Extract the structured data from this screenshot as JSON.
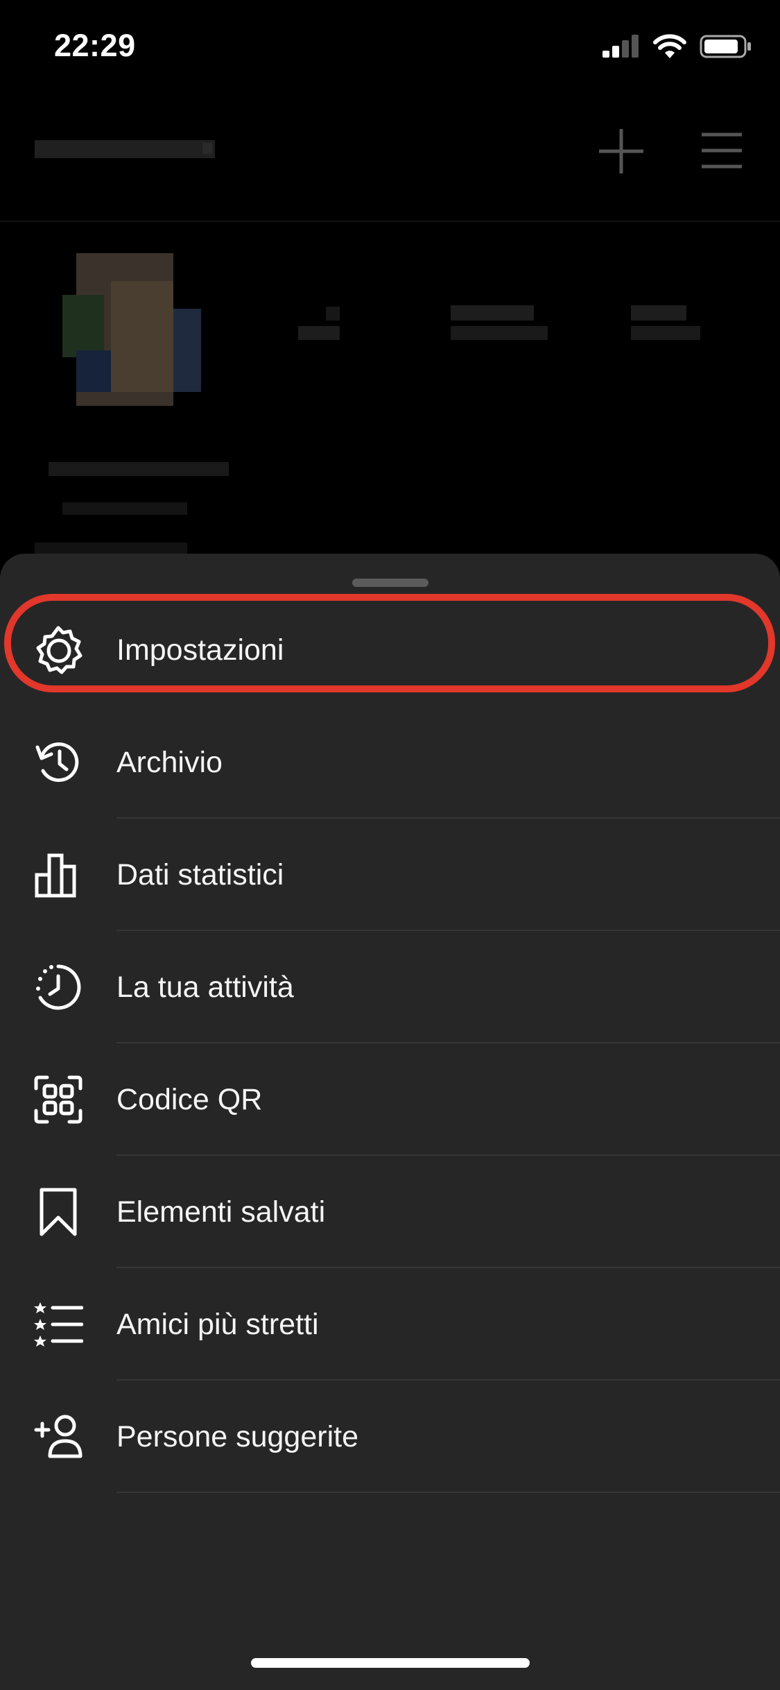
{
  "status_bar": {
    "time": "22:29"
  },
  "menu": {
    "items": [
      {
        "label": "Impostazioni",
        "icon": "settings-gear-icon"
      },
      {
        "label": "Archivio",
        "icon": "archive-history-icon"
      },
      {
        "label": "Dati statistici",
        "icon": "insights-bar-chart-icon"
      },
      {
        "label": "La tua attività",
        "icon": "your-activity-clock-icon"
      },
      {
        "label": "Codice QR",
        "icon": "qr-code-icon"
      },
      {
        "label": "Elementi salvati",
        "icon": "bookmark-icon"
      },
      {
        "label": "Amici più stretti",
        "icon": "close-friends-list-icon"
      },
      {
        "label": "Persone suggerite",
        "icon": "add-person-icon"
      }
    ]
  },
  "colors": {
    "highlight": "#e2372b",
    "sheet": "#262626"
  }
}
